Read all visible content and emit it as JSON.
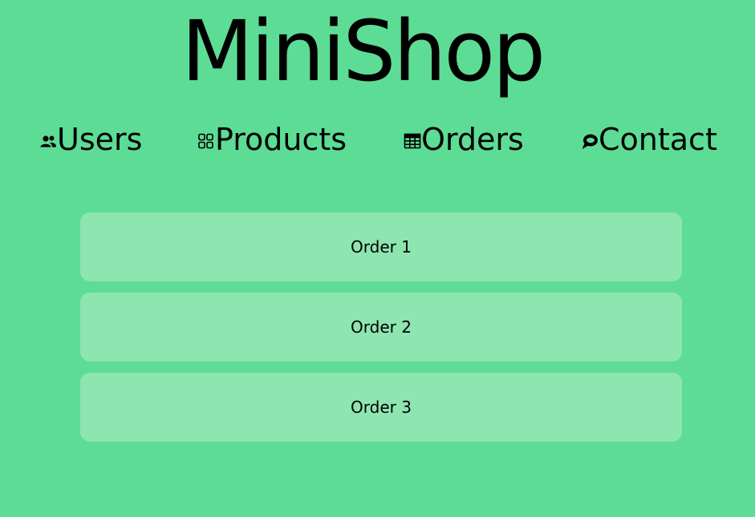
{
  "app": {
    "title": "MiniShop"
  },
  "nav": {
    "items": [
      {
        "label": "Users",
        "icon": "users-icon"
      },
      {
        "label": "Products",
        "icon": "grid-icon"
      },
      {
        "label": "Orders",
        "icon": "table-icon"
      },
      {
        "label": "Contact",
        "icon": "chat-icon"
      }
    ]
  },
  "orders": {
    "items": [
      {
        "label": "Order 1"
      },
      {
        "label": "Order 2"
      },
      {
        "label": "Order 3"
      }
    ]
  },
  "colors": {
    "background": "#5ddc95",
    "card": "#8de5b0",
    "text": "#000000"
  }
}
